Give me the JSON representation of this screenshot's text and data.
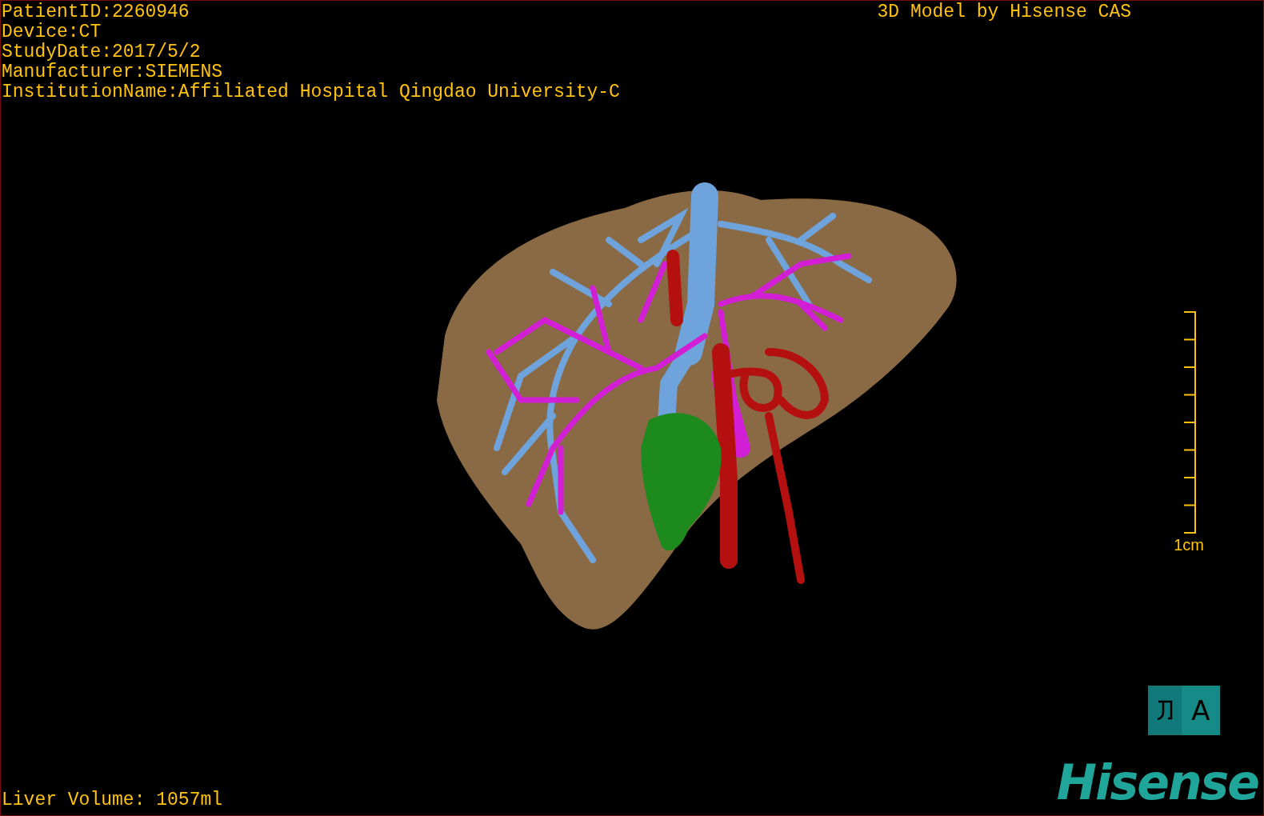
{
  "info_lines": [
    "PatientID:2260946",
    "Device:CT",
    "StudyDate:2017/5/2",
    "Manufacturer:SIEMENS",
    "InstitutionName:Affiliated Hospital Qingdao University-C"
  ],
  "title": "3D Model by Hisense CAS",
  "scale_bar": {
    "label": "1cm"
  },
  "liver_volume": "Liver Volume: 1057ml",
  "input_mode": {
    "label": "A"
  },
  "logo": "Hisense"
}
